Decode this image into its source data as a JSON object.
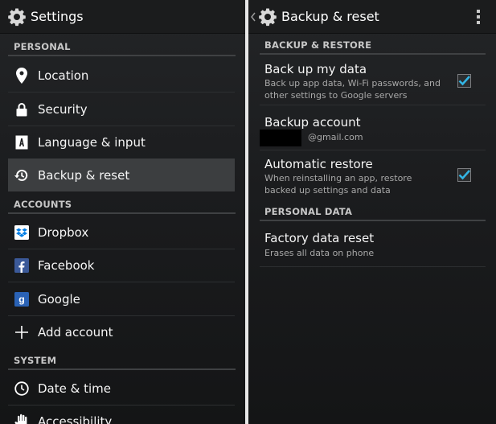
{
  "left": {
    "title": "Settings",
    "sections": {
      "personal": "PERSONAL",
      "accounts": "ACCOUNTS",
      "system": "SYSTEM"
    },
    "items": {
      "location": "Location",
      "security": "Security",
      "language": "Language & input",
      "backup": "Backup & reset",
      "dropbox": "Dropbox",
      "facebook": "Facebook",
      "google": "Google",
      "add_account": "Add account",
      "date_time": "Date & time",
      "accessibility": "Accessibility"
    },
    "selected_item": "backup"
  },
  "right": {
    "title": "Backup & reset",
    "sections": {
      "backup_restore": "BACKUP & RESTORE",
      "personal_data": "PERSONAL DATA"
    },
    "back_up_data": {
      "title": "Back up my data",
      "summary": "Back up app data, Wi-Fi passwords, and other settings to Google servers",
      "checked": true
    },
    "backup_account": {
      "title": "Backup account",
      "email": "@gmail.com"
    },
    "automatic_restore": {
      "title": "Automatic restore",
      "summary": "When reinstalling an app, restore backed up settings and data",
      "checked": true
    },
    "factory_reset": {
      "title": "Factory data reset",
      "summary": "Erases all data on phone"
    }
  },
  "colors": {
    "accent": "#33b5e5",
    "background": "#1b1c1e",
    "divider": "#3f4143",
    "selected": "#3c3e40",
    "dropbox": "#007ee5",
    "facebook": "#3b5998",
    "google": "#2a62b5"
  },
  "icons": {
    "settings": "gear-icon",
    "location": "map-pin-icon",
    "security": "lock-icon",
    "language": "keyboard-a-icon",
    "backup": "restore-clock-icon",
    "dropbox": "dropbox-icon",
    "facebook": "facebook-icon",
    "google": "google-icon",
    "add_account": "plus-icon",
    "date_time": "clock-icon",
    "accessibility": "hand-icon",
    "overflow": "overflow-menu-icon",
    "back": "back-caret-icon"
  }
}
